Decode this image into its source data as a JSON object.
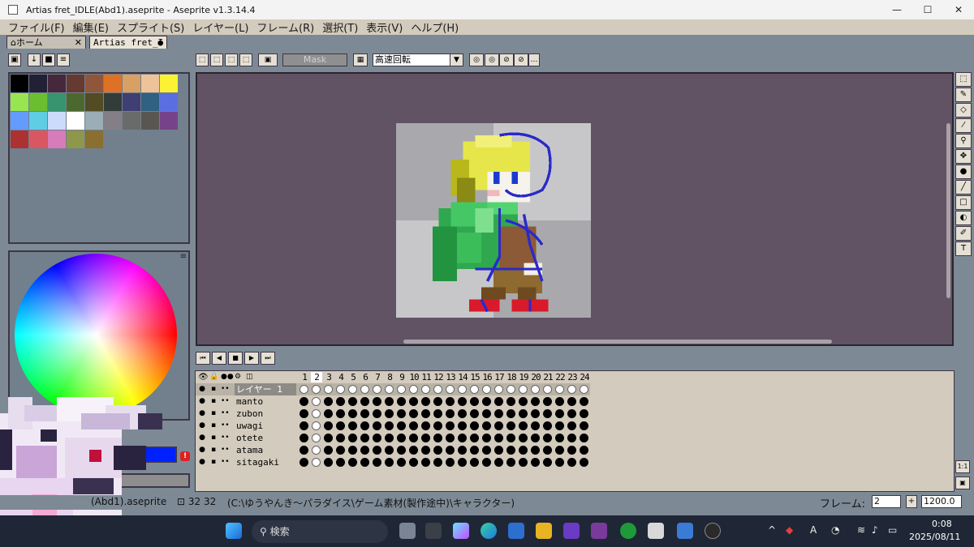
{
  "window": {
    "title": "Artias fret_IDLE(Abd1).aseprite - Aseprite v1.3.14.4",
    "controls": [
      "—",
      "☐",
      "✕"
    ]
  },
  "menu": [
    "ファイル(F)",
    "編集(E)",
    "スプライト(S)",
    "レイヤー(L)",
    "フレーム(R)",
    "選択(T)",
    "表示(V)",
    "ヘルプ(H)"
  ],
  "tabs": {
    "home": "ホーム",
    "file": "Artias fret_I",
    "close": "✕"
  },
  "toolbar": {
    "mask": "Mask",
    "mode": "高速回転",
    "mode_arrow": "▼"
  },
  "palette": {
    "colors": [
      "#000000",
      "#222034",
      "#45283c",
      "#663931",
      "#8f563b",
      "#df7126",
      "#d9a066",
      "#eec39a",
      "#fbf236",
      "#99e550",
      "#6abe30",
      "#37946e",
      "#4b692f",
      "#524b24",
      "#323c39",
      "#3f3f74",
      "#306082",
      "#5b6ee1",
      "#639bff",
      "#5fcde4",
      "#cbdbfc",
      "#ffffff",
      "#9badb7",
      "#847e87",
      "#696a6a",
      "#595652",
      "#76428a",
      "#ac3232",
      "#d95763",
      "#d77bba",
      "#8f974a",
      "#8a6f30"
    ]
  },
  "timeline": {
    "frames": [
      "1",
      "2",
      "3",
      "4",
      "5",
      "6",
      "7",
      "8",
      "9",
      "10",
      "11",
      "12",
      "13",
      "14",
      "15",
      "16",
      "17",
      "18",
      "19",
      "20",
      "21",
      "22",
      "23",
      "24"
    ],
    "layers": [
      {
        "name": "レイヤー 1",
        "selected": true
      },
      {
        "name": "manto"
      },
      {
        "name": "zubon"
      },
      {
        "name": "uwagi"
      },
      {
        "name": "otete"
      },
      {
        "name": "atama"
      },
      {
        "name": "sitagaki"
      }
    ]
  },
  "status": {
    "file": "(Abd1).aseprite",
    "size": "32 32",
    "path": "(C:\\ゆうやんき～パラダイス\\ゲーム素材(製作途中)\\キャラクター)",
    "frame_label": "フレーム:",
    "frame_value": "2",
    "plus": "+",
    "zoom": "1200.0"
  },
  "taskbar": {
    "search": "検索",
    "time": "0:08",
    "date": "2025/08/11",
    "ime": "A"
  }
}
